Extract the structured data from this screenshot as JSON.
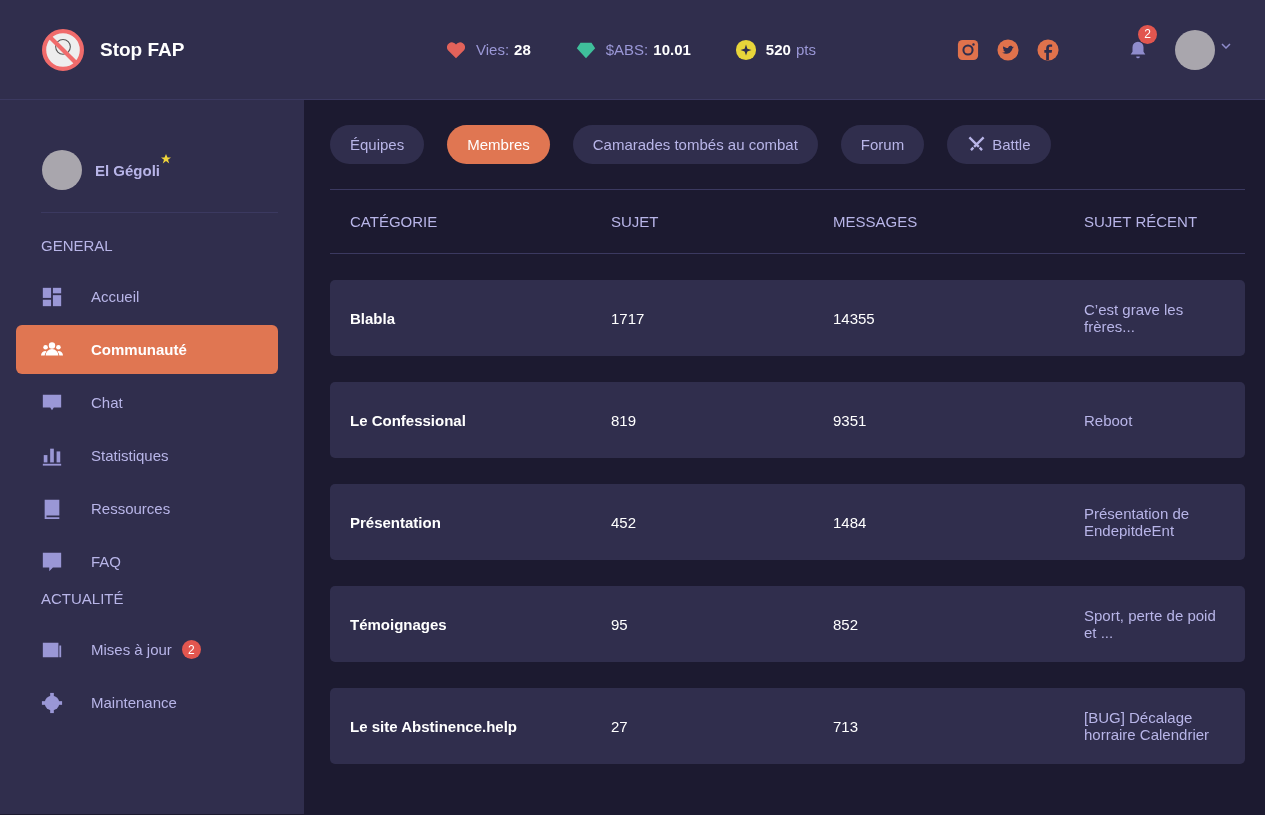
{
  "header": {
    "brand": "Stop FAP",
    "stats": [
      {
        "kind": "lives",
        "label": "Vies:",
        "value": "28"
      },
      {
        "kind": "token",
        "label": "$ABS:",
        "value": "10.01"
      },
      {
        "kind": "points",
        "value": "520",
        "unit": "pts"
      }
    ],
    "notifications": "2"
  },
  "sidebar": {
    "user": "El Gégoli",
    "sections": [
      {
        "title": "GENERAL",
        "items": [
          {
            "label": "Accueil",
            "selected": false
          },
          {
            "label": "Communauté",
            "selected": true
          },
          {
            "label": "Chat",
            "selected": false
          },
          {
            "label": "Statistiques",
            "selected": false
          },
          {
            "label": "Ressources",
            "selected": false
          },
          {
            "label": "FAQ",
            "selected": false
          }
        ]
      },
      {
        "title": "ACTUALITÉ",
        "items": [
          {
            "label": "Mises à jour",
            "selected": false,
            "badge": "2"
          },
          {
            "label": "Maintenance",
            "selected": false
          }
        ]
      }
    ]
  },
  "tabs": [
    {
      "label": "Équipes",
      "selected": false
    },
    {
      "label": "Membres",
      "selected": true
    },
    {
      "label": "Camarades tombés au combat",
      "selected": false
    },
    {
      "label": "Forum",
      "selected": false
    },
    {
      "label": "Battle",
      "selected": false,
      "icon": true
    }
  ],
  "table": {
    "columns": [
      "CATÉGORIE",
      "SUJET",
      "MESSAGES",
      "SUJET RÉCENT"
    ],
    "rows": [
      [
        "Blabla",
        "1717",
        "14355",
        "C’est grave les frères..."
      ],
      [
        "Le Confessional",
        "819",
        "9351",
        "Reboot"
      ],
      [
        "Présentation",
        "452",
        "1484",
        "Présentation de EndepitdeEnt"
      ],
      [
        "Témoignages",
        "95",
        "852",
        "Sport, perte de poid et ..."
      ],
      [
        "Le site Abstinence.help",
        "27",
        "713",
        "[BUG] Décalage horraire Calendrier"
      ]
    ]
  }
}
